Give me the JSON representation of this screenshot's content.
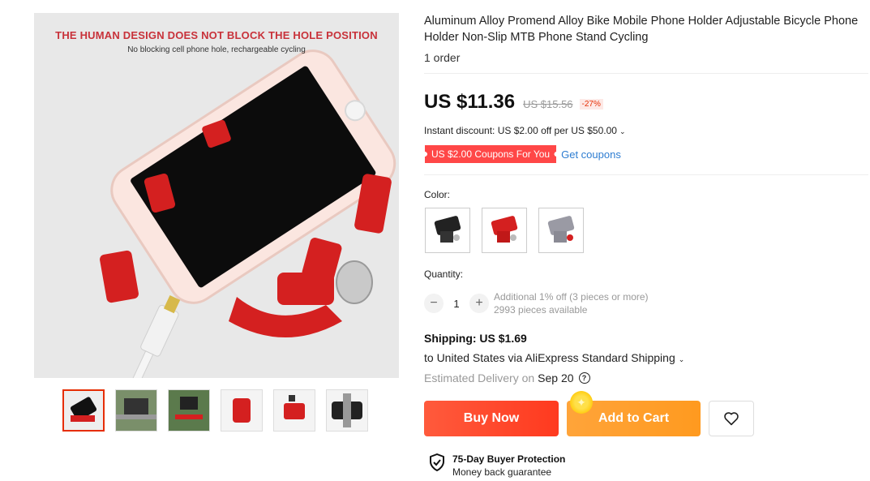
{
  "gallery": {
    "banner_title": "THE HUMAN DESIGN DOES NOT BLOCK THE HOLE POSITION",
    "banner_subtitle": "No blocking cell phone hole, rechargeable cycling",
    "thumbnail_count": 6,
    "selected_thumbnail": 1
  },
  "product": {
    "title": "Aluminum Alloy Promend Alloy Bike Mobile Phone Holder Adjustable Bicycle Phone Holder Non-Slip MTB Phone Stand Cycling",
    "orders": "1 order"
  },
  "pricing": {
    "price": "US $11.36",
    "original_price": "US $15.56",
    "discount": "-27%",
    "instant_discount": "Instant discount: US $2.00 off per US $50.00",
    "coupon_tag": "US $2.00 Coupons For You",
    "get_coupons": "Get coupons"
  },
  "color": {
    "label": "Color:",
    "options": [
      "black",
      "red",
      "silver"
    ]
  },
  "quantity": {
    "label": "Quantity:",
    "decrement": "−",
    "value": "1",
    "increment": "+",
    "additional_off": "Additional 1% off (3 pieces or more)",
    "available": "2993 pieces available"
  },
  "shipping": {
    "price": "Shipping: US $1.69",
    "destination": "to United States via AliExpress Standard Shipping",
    "eta_label": "Estimated Delivery on",
    "eta_date": "Sep 20"
  },
  "actions": {
    "buy_now": "Buy Now",
    "add_to_cart": "Add to Cart"
  },
  "protection": {
    "title": "75-Day Buyer Protection",
    "subtitle": "Money back guarantee"
  },
  "colors": {
    "accent_red": "#ff4747",
    "buy_now": "#ff4422",
    "add_to_cart": "#ffa02e",
    "product_red": "#d42020",
    "link_blue": "#2e7dd1"
  }
}
